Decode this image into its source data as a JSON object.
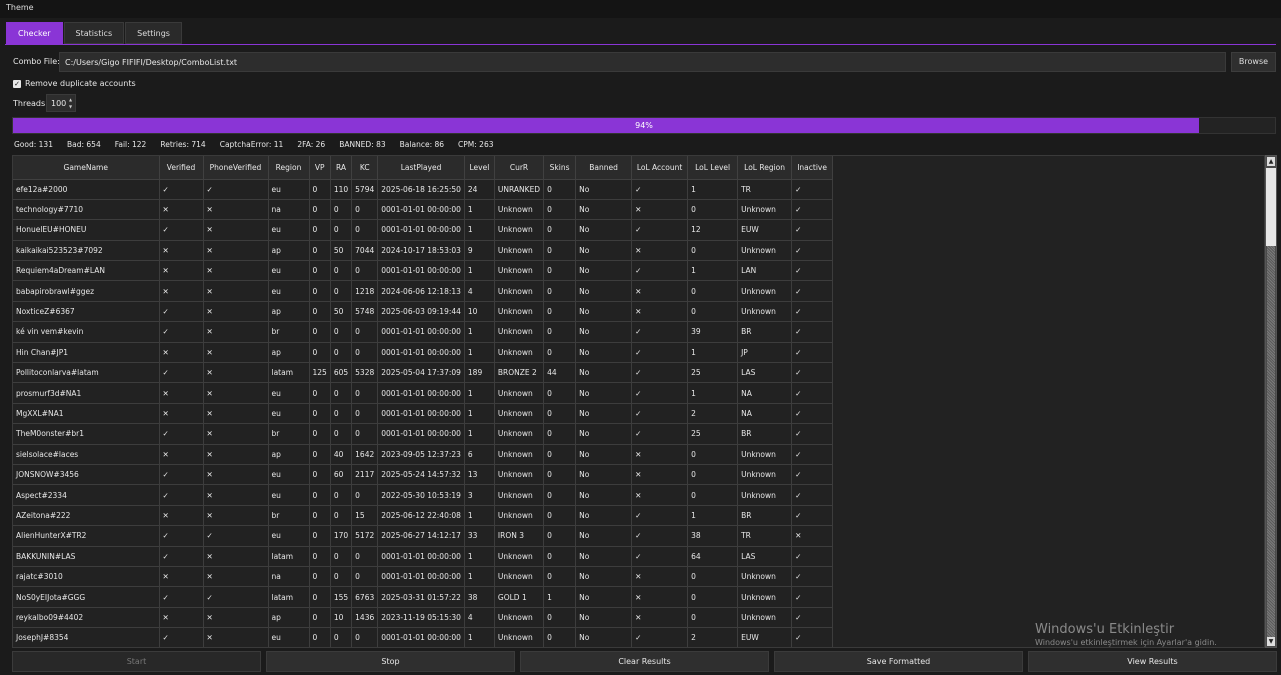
{
  "menu": {
    "theme": "Theme"
  },
  "tabs": [
    {
      "label": "Checker"
    },
    {
      "label": "Statistics"
    },
    {
      "label": "Settings"
    }
  ],
  "combo": {
    "label": "Combo File:",
    "value": "C:/Users/Gigo FIFIFI/Desktop/ComboList.txt",
    "browse": "Browse"
  },
  "options": {
    "remove_dup": "Remove duplicate accounts",
    "threads_label": "Threads:",
    "threads_value": "100"
  },
  "progress": {
    "text": "94%",
    "value": 0.94
  },
  "stats": {
    "good": "Good: 131",
    "bad": "Bad: 654",
    "fail": "Fail: 122",
    "retries": "Retries: 714",
    "captcha": "CaptchaError: 11",
    "twofa": "2FA: 26",
    "banned": "BANNED: 83",
    "balance": "Balance: 86",
    "cpm": "CPM: 263"
  },
  "table": {
    "columns": [
      "GameName",
      "Verified",
      "PhoneVerified",
      "Region",
      "VP",
      "RA",
      "KC",
      "LastPlayed",
      "Level",
      "CurR",
      "Skins",
      "Banned",
      "LoL Account",
      "LoL Level",
      "LoL Region",
      "Inactive"
    ],
    "rows": [
      [
        "efe12a#2000",
        "✓",
        "✓",
        "eu",
        "0",
        "110",
        "5794",
        "2025-06-18 16:25:50",
        "24",
        "UNRANKED",
        "0",
        "No",
        "✓",
        "1",
        "TR",
        "✓"
      ],
      [
        "technology#7710",
        "✕",
        "✕",
        "na",
        "0",
        "0",
        "0",
        "0001-01-01 00:00:00",
        "1",
        "Unknown",
        "0",
        "No",
        "✕",
        "0",
        "Unknown",
        "✓"
      ],
      [
        "HonuelEU#HONEU",
        "✓",
        "✕",
        "eu",
        "0",
        "0",
        "0",
        "0001-01-01 00:00:00",
        "1",
        "Unknown",
        "0",
        "No",
        "✓",
        "12",
        "EUW",
        "✓"
      ],
      [
        "kaikaikai523523#7092",
        "✕",
        "✕",
        "ap",
        "0",
        "50",
        "7044",
        "2024-10-17 18:53:03",
        "9",
        "Unknown",
        "0",
        "No",
        "✕",
        "0",
        "Unknown",
        "✓"
      ],
      [
        "Requiem4aDream#LAN",
        "✕",
        "✕",
        "eu",
        "0",
        "0",
        "0",
        "0001-01-01 00:00:00",
        "1",
        "Unknown",
        "0",
        "No",
        "✓",
        "1",
        "LAN",
        "✓"
      ],
      [
        "babapirobrawl#ggez",
        "✕",
        "✕",
        "eu",
        "0",
        "0",
        "1218",
        "2024-06-06 12:18:13",
        "4",
        "Unknown",
        "0",
        "No",
        "✕",
        "0",
        "Unknown",
        "✓"
      ],
      [
        "NoxticeZ#6367",
        "✓",
        "✕",
        "ap",
        "0",
        "50",
        "5748",
        "2025-06-03 09:19:44",
        "10",
        "Unknown",
        "0",
        "No",
        "✕",
        "0",
        "Unknown",
        "✓"
      ],
      [
        "ké vin vem#kevin",
        "✓",
        "✕",
        "br",
        "0",
        "0",
        "0",
        "0001-01-01 00:00:00",
        "1",
        "Unknown",
        "0",
        "No",
        "✓",
        "39",
        "BR",
        "✓"
      ],
      [
        "Hin Chan#JP1",
        "✕",
        "✕",
        "ap",
        "0",
        "0",
        "0",
        "0001-01-01 00:00:00",
        "1",
        "Unknown",
        "0",
        "No",
        "✓",
        "1",
        "JP",
        "✓"
      ],
      [
        "Pollitoconlarva#latam",
        "✓",
        "✕",
        "latam",
        "125",
        "605",
        "5328",
        "2025-05-04 17:37:09",
        "189",
        "BRONZE 2",
        "44",
        "No",
        "✓",
        "25",
        "LAS",
        "✓"
      ],
      [
        "prosmurf3d#NA1",
        "✕",
        "✕",
        "eu",
        "0",
        "0",
        "0",
        "0001-01-01 00:00:00",
        "1",
        "Unknown",
        "0",
        "No",
        "✓",
        "1",
        "NA",
        "✓"
      ],
      [
        "MgXXL#NA1",
        "✕",
        "✕",
        "eu",
        "0",
        "0",
        "0",
        "0001-01-01 00:00:00",
        "1",
        "Unknown",
        "0",
        "No",
        "✓",
        "2",
        "NA",
        "✓"
      ],
      [
        "TheM0onster#br1",
        "✓",
        "✕",
        "br",
        "0",
        "0",
        "0",
        "0001-01-01 00:00:00",
        "1",
        "Unknown",
        "0",
        "No",
        "✓",
        "25",
        "BR",
        "✓"
      ],
      [
        "sielsolace#laces",
        "✕",
        "✕",
        "ap",
        "0",
        "40",
        "1642",
        "2023-09-05 12:37:23",
        "6",
        "Unknown",
        "0",
        "No",
        "✕",
        "0",
        "Unknown",
        "✓"
      ],
      [
        "JONSNOW#3456",
        "✓",
        "✕",
        "eu",
        "0",
        "60",
        "2117",
        "2025-05-24 14:57:32",
        "13",
        "Unknown",
        "0",
        "No",
        "✕",
        "0",
        "Unknown",
        "✓"
      ],
      [
        "Aspect#2334",
        "✓",
        "✕",
        "eu",
        "0",
        "0",
        "0",
        "2022-05-30 10:53:19",
        "3",
        "Unknown",
        "0",
        "No",
        "✕",
        "0",
        "Unknown",
        "✓"
      ],
      [
        "AZeitona#222",
        "✕",
        "✕",
        "br",
        "0",
        "0",
        "15",
        "2025-06-12 22:40:08",
        "1",
        "Unknown",
        "0",
        "No",
        "✓",
        "1",
        "BR",
        "✓"
      ],
      [
        "AlienHunterX#TR2",
        "✓",
        "✓",
        "eu",
        "0",
        "170",
        "5172",
        "2025-06-27 14:12:17",
        "33",
        "IRON 3",
        "0",
        "No",
        "✓",
        "38",
        "TR",
        "✕"
      ],
      [
        "BAKKUNIN#LAS",
        "✓",
        "✕",
        "latam",
        "0",
        "0",
        "0",
        "0001-01-01 00:00:00",
        "1",
        "Unknown",
        "0",
        "No",
        "✓",
        "64",
        "LAS",
        "✓"
      ],
      [
        "rajatc#3010",
        "✕",
        "✕",
        "na",
        "0",
        "0",
        "0",
        "0001-01-01 00:00:00",
        "1",
        "Unknown",
        "0",
        "No",
        "✕",
        "0",
        "Unknown",
        "✓"
      ],
      [
        "NoS0yEIJota#GGG",
        "✓",
        "✓",
        "latam",
        "0",
        "155",
        "6763",
        "2025-03-31 01:57:22",
        "38",
        "GOLD 1",
        "1",
        "No",
        "✕",
        "0",
        "Unknown",
        "✓"
      ],
      [
        "reykalbo09#4402",
        "✕",
        "✕",
        "ap",
        "0",
        "10",
        "1436",
        "2023-11-19 05:15:30",
        "4",
        "Unknown",
        "0",
        "No",
        "✕",
        "0",
        "Unknown",
        "✓"
      ],
      [
        "JosephJ#8354",
        "✓",
        "✕",
        "eu",
        "0",
        "0",
        "0",
        "0001-01-01 00:00:00",
        "1",
        "Unknown",
        "0",
        "No",
        "✓",
        "2",
        "EUW",
        "✓"
      ]
    ]
  },
  "buttons": {
    "start": "Start",
    "stop": "Stop",
    "clear": "Clear Results",
    "save": "Save Formatted",
    "view": "View Results"
  },
  "watermark": {
    "line1": "Windows'u Etkinleştir",
    "line2": "Windows'u etkinleştirmek için Ayarlar'a gidin."
  },
  "colors": {
    "accent": "#8a35d6",
    "background": "#1b1b1b"
  }
}
